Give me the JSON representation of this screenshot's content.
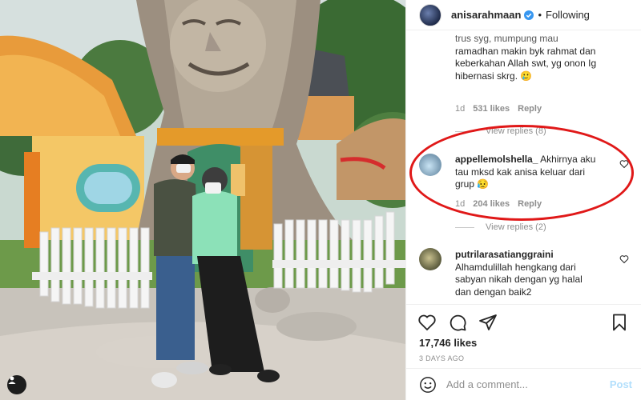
{
  "header": {
    "username": "anisarahmaan",
    "separator": "•",
    "follow_label": "Following"
  },
  "comments": {
    "first": {
      "text_lines": [
        "trus syg, mumpung mau",
        "ramadhan makin byk rahmat dan",
        "keberkahan Allah swt, yg onon Ig",
        "hibernasi skrg. 🥲"
      ],
      "age": "1d",
      "likes": "531 likes",
      "reply_label": "Reply",
      "view_replies": "View replies (8)"
    },
    "second": {
      "username": "appellemolshella_",
      "text_first": "Akhirnya aku",
      "text_lines": [
        "tau mksd kak anisa keluar dari",
        "grup 😥"
      ],
      "age": "1d",
      "likes": "204 likes",
      "reply_label": "Reply",
      "view_replies": "View replies (2)"
    },
    "third": {
      "username": "putrilarasatianggraini",
      "text_lines": [
        "Alhamdulillah hengkang dari",
        "sabyan nikah dengan yg halal",
        "dan dengan baik2"
      ]
    }
  },
  "actions": {
    "likes": "17,746 likes",
    "posted": "3 DAYS AGO"
  },
  "add_comment": {
    "placeholder": "Add a comment...",
    "post_label": "Post"
  },
  "colors": {
    "accent_red": "#e01818",
    "post_blue": "#b2dffc",
    "verified_blue": "#3897f0"
  },
  "icons": [
    "heart-icon",
    "comment-icon",
    "share-icon",
    "bookmark-icon",
    "emoji-icon",
    "verified-badge-icon",
    "user-tag-icon"
  ]
}
